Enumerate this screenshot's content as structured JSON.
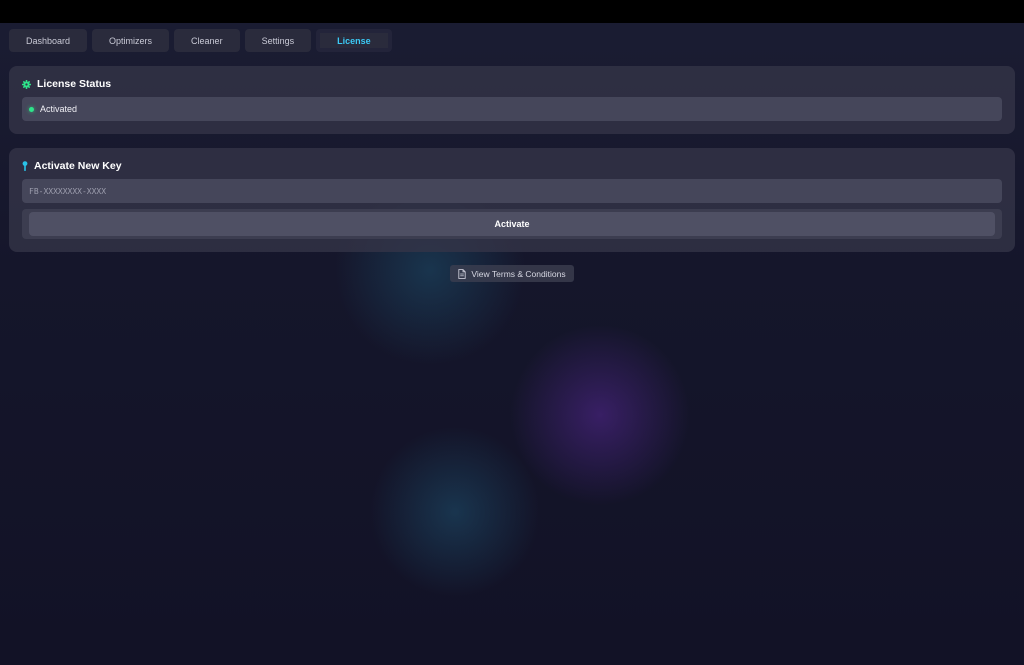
{
  "nav": {
    "tabs": [
      {
        "label": "Dashboard"
      },
      {
        "label": "Optimizers"
      },
      {
        "label": "Cleaner"
      },
      {
        "label": "Settings"
      },
      {
        "label": "License",
        "active": true
      }
    ]
  },
  "license_status": {
    "title": "License Status",
    "icon": "gear-icon",
    "status_text": "Activated",
    "status_color": "#2ee58a"
  },
  "activate_key": {
    "title": "Activate New Key",
    "icon": "pin-icon",
    "input_value": "",
    "input_placeholder": "FB-XXXXXXXX-XXXX",
    "button_label": "Activate"
  },
  "terms": {
    "label": "View Terms & Conditions",
    "icon": "document-icon"
  },
  "colors": {
    "accent": "#3bc9f5",
    "status_green": "#2ee58a",
    "pin_cyan": "#29c3e8"
  }
}
